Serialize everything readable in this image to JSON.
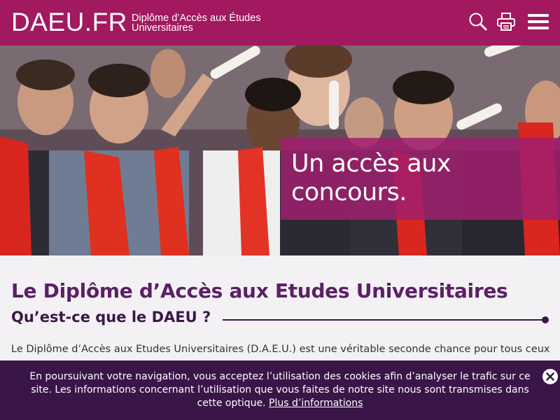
{
  "header": {
    "logo": "DAEU.FR",
    "tagline": "Diplôme d’Accès aux Études Universitaires",
    "icons": [
      "search-icon",
      "print-icon",
      "hamburger-menu-icon"
    ],
    "brand_color": "#a2195f"
  },
  "hero": {
    "caption": "Un accès aux concours.",
    "caption_color": "#a01e6e"
  },
  "main": {
    "title": "Le Diplôme d’Accès aux Etudes Universitaires",
    "section_heading": "Qu’est-ce que le DAEU ?",
    "intro": "Le Diplôme d’Accès aux Etudes Universitaires (D.A.E.U.) est une véritable seconde chance pour tous ceux",
    "title_color": "#5b2066"
  },
  "cookie_banner": {
    "text": "En poursuivant votre navigation, vous acceptez l’utilisation des cookies afin d’analyser le trafic sur ce site. Les informations concernant l’utilisation que vous faites de notre site nous sont transmises dans cette optique.",
    "link_label": "Plus d’informations",
    "background": "#3a1548"
  }
}
